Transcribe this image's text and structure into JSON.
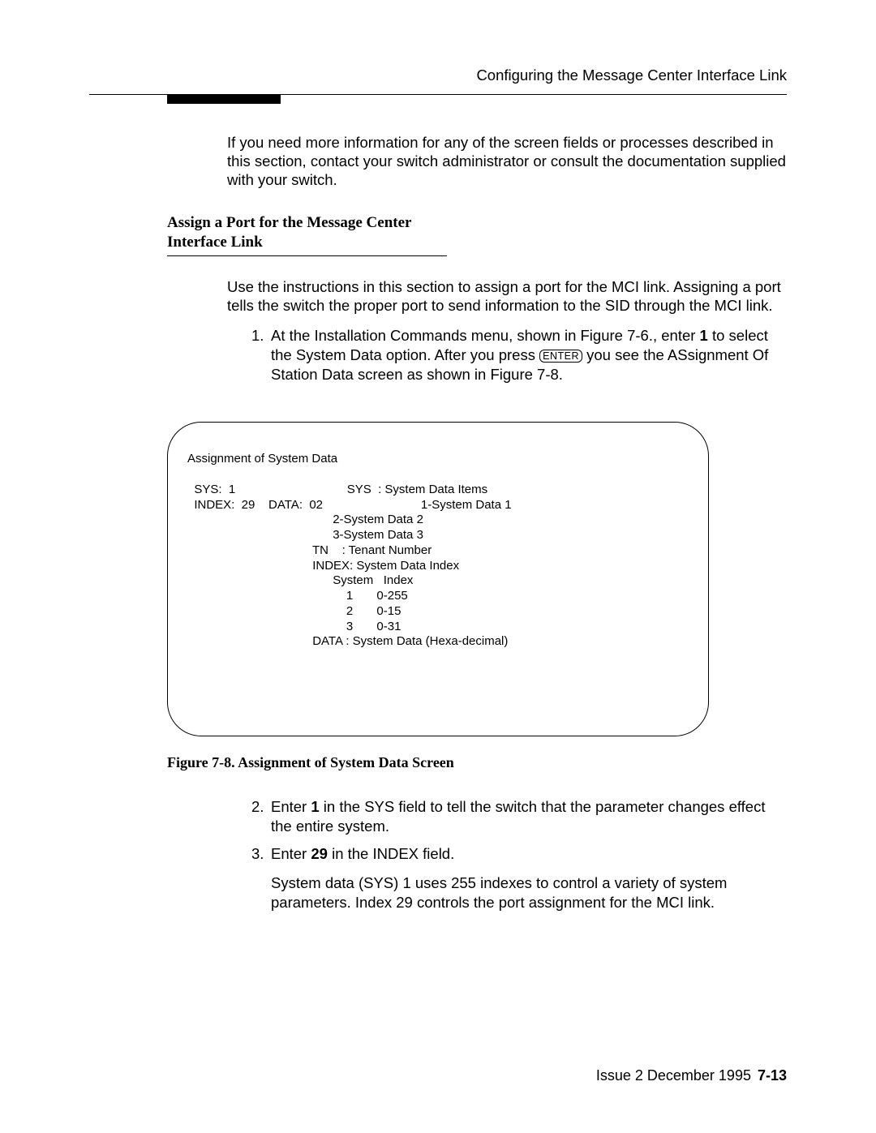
{
  "header": {
    "running_title": "Configuring the Message Center Interface Link"
  },
  "intro_paragraph": "If you need more information for any of the screen fields or processes described in this section, contact your switch administrator or consult the documentation supplied with your switch.",
  "section": {
    "heading_line1": "Assign a Port for the Message Center",
    "heading_line2": "Interface Link",
    "paragraph": "Use the instructions in this section to assign a port for the MCI link.  Assigning a port tells the switch the proper port to send information to the SID through the MCI link."
  },
  "step1": {
    "number": "1.",
    "text_before_bold1": "At the Installation Commands menu, shown in Figure 7-6., enter ",
    "bold1": "1",
    "text_after_bold1": " to select the System Data option.  After you press ",
    "enter_key": "ENTER",
    "text_after_key": " you see the ASsignment Of Station Data screen as shown in Figure 7-8."
  },
  "screen": {
    "title": "Assignment of System Data",
    "line_sys": "  SYS:  1",
    "line_sys_right": "SYS  : System Data Items",
    "line_index": "  INDEX:  29    DATA:  02",
    "right_1": "1-System Data 1",
    "right_2": "2-System Data 2",
    "right_3": "3-System Data 3",
    "right_tn": "TN    : Tenant Number",
    "right_index": "INDEX: System Data Index",
    "right_sysidx": "System   Index",
    "right_row1": "    1       0-255",
    "right_row2": "    2       0-15",
    "right_row3": "    3       0-31",
    "right_data": "DATA : System Data (Hexa-decimal)"
  },
  "figure_caption": "Figure 7-8.  Assignment of System Data Screen",
  "step2": {
    "number": "2.",
    "text_before": "Enter ",
    "bold": "1",
    "text_after": " in the SYS field to tell the switch that the parameter changes effect the entire system."
  },
  "step3": {
    "number": "3.",
    "text_before": "Enter ",
    "bold": "29",
    "text_after": " in the INDEX field.",
    "followup": "System data (SYS) 1 uses 255 indexes to control a variety of system parameters. Index 29 controls the port assignment for the MCI link."
  },
  "footer": {
    "issue": "Issue 2   December 1995",
    "page": "7-13"
  }
}
